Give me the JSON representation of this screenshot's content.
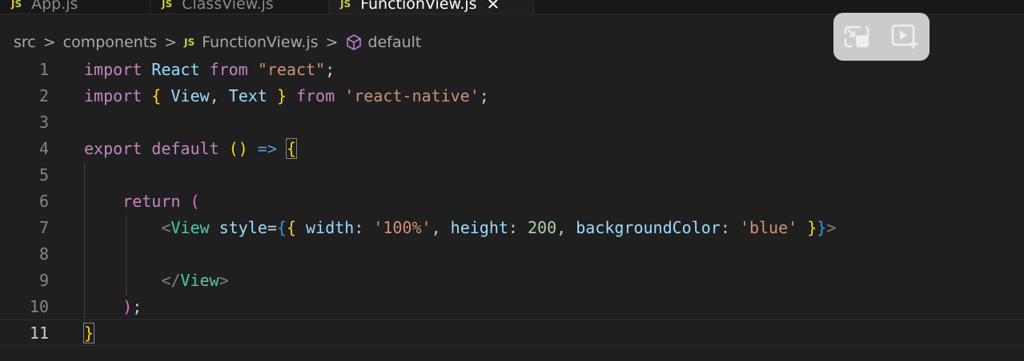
{
  "tabs": [
    {
      "label": "App.js",
      "badge": "JS"
    },
    {
      "label": "ClassView.js",
      "badge": "JS"
    },
    {
      "label": "FunctionView.js",
      "badge": "JS",
      "active": true
    }
  ],
  "breadcrumb": {
    "items": [
      "src",
      "components",
      "FunctionView.js",
      "default"
    ],
    "file_badge": "JS",
    "separator": ">"
  },
  "editor": {
    "line_numbers": [
      "1",
      "2",
      "3",
      "4",
      "5",
      "6",
      "7",
      "8",
      "9",
      "10",
      "11"
    ],
    "current_line": 11,
    "language": "javascript",
    "lines": [
      "import React from \"react\";",
      "import { View, Text } from 'react-native';",
      "",
      "export default () => {",
      "",
      "    return (",
      "        <View style={{ width: '100%', height: 200, backgroundColor: 'blue' }}>",
      "",
      "        </View>",
      "    );",
      "}"
    ]
  },
  "video_controls": {
    "buttons": [
      "pip-exit-icon",
      "video-magic-icon"
    ]
  },
  "colors": {
    "background": "#1f1f1f",
    "keyword": "#c586c0",
    "string": "#ce9178",
    "variable": "#9cdcfe",
    "type": "#4ec9b0",
    "bracket_gold": "#ffd700"
  }
}
